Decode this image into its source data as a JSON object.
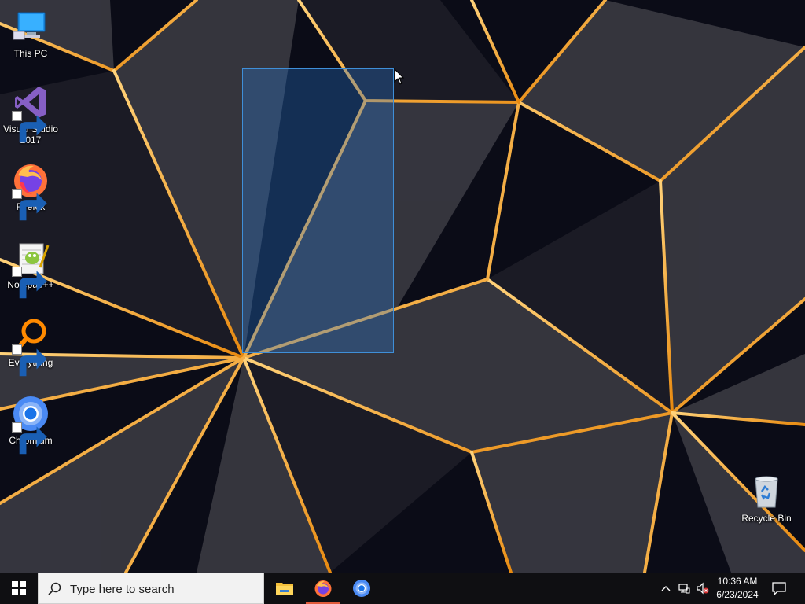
{
  "desktop": {
    "icons": [
      {
        "label": "This PC",
        "icon": "this-pc-icon"
      },
      {
        "label": "Visual Studio 2017",
        "icon": "visual-studio-icon"
      },
      {
        "label": "Firefox",
        "icon": "firefox-icon"
      },
      {
        "label": "Notepad++",
        "icon": "notepad-plus-plus-icon"
      },
      {
        "label": "Everything",
        "icon": "everything-icon"
      },
      {
        "label": "Chromium",
        "icon": "chromium-icon"
      },
      {
        "label": "Recycle Bin",
        "icon": "recycle-bin-icon"
      }
    ]
  },
  "taskbar": {
    "search_placeholder": "Type here to search",
    "pinned": [
      "file-explorer-icon",
      "firefox-icon",
      "chromium-icon"
    ],
    "clock": {
      "time": "10:36 AM",
      "date": "6/23/2024"
    }
  },
  "colors": {
    "taskbar": "#0f0f12",
    "selection": "#3f8fd8",
    "wallpaper_accent": "#f6a623"
  }
}
